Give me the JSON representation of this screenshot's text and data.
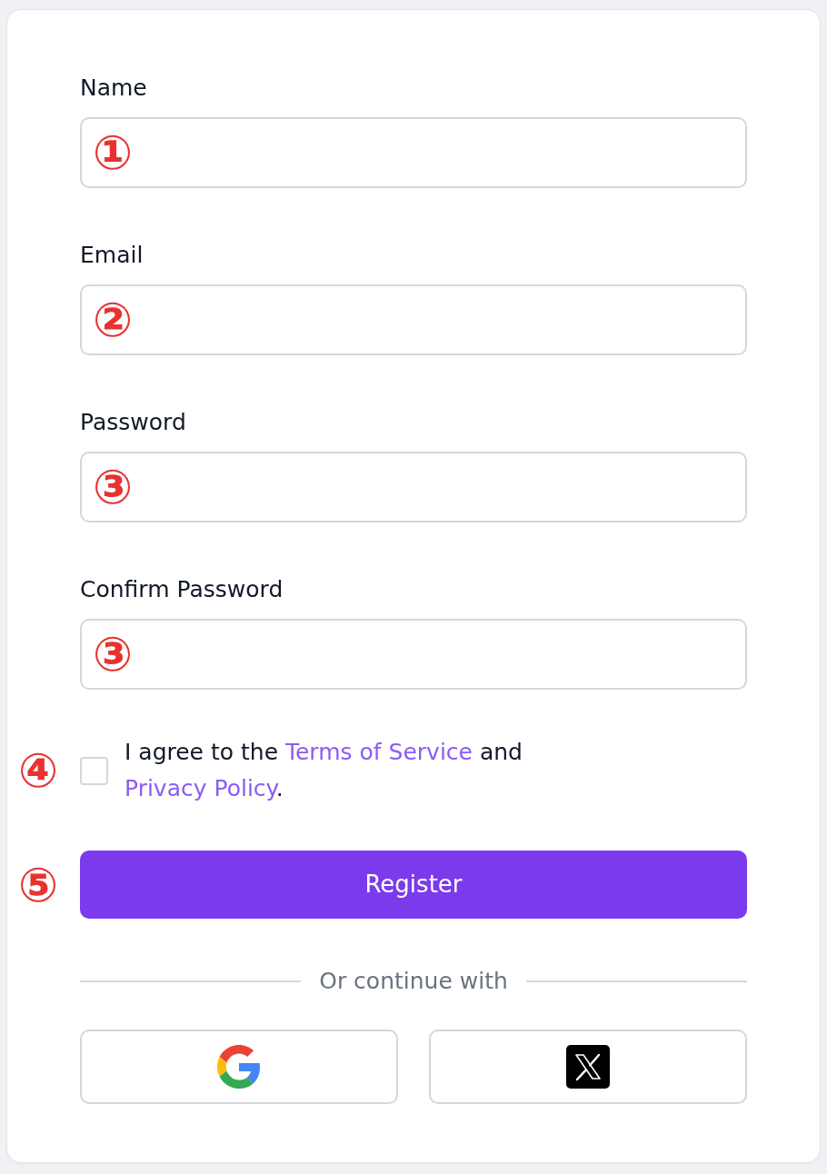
{
  "fields": [
    {
      "label": "Name",
      "marker": "①"
    },
    {
      "label": "Email",
      "marker": "②"
    },
    {
      "label": "Password",
      "marker": "③"
    },
    {
      "label": "Confirm Password",
      "marker": "③"
    }
  ],
  "agreement": {
    "checked": false,
    "marker": "④",
    "parts": [
      {
        "kind": "text",
        "text": "I agree to the "
      },
      {
        "kind": "link",
        "text": "Terms of Service"
      },
      {
        "kind": "text",
        "text": " and "
      },
      {
        "kind": "link",
        "text": "Privacy Policy"
      },
      {
        "kind": "text",
        "text": "."
      }
    ]
  },
  "submit": {
    "label": "Register",
    "marker": "⑤"
  },
  "divider": "Or continue with",
  "social_buttons": [
    {
      "kind": "google"
    },
    {
      "kind": "x"
    }
  ]
}
